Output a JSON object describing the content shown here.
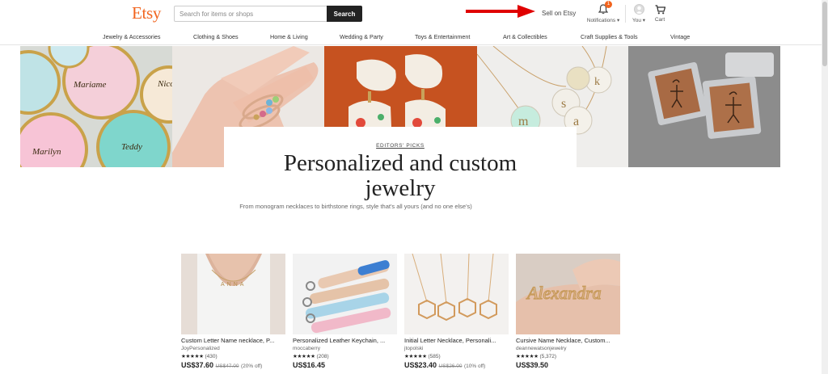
{
  "header": {
    "logo": "Etsy",
    "search_placeholder": "Search for items or shops",
    "search_button": "Search",
    "sell_link": "Sell on Etsy",
    "notifications_label": "Notifications ▾",
    "notifications_count": "1",
    "you_label": "You ▾",
    "cart_label": "Cart"
  },
  "categories": [
    "Jewelry & Accessories",
    "Clothing & Shoes",
    "Home & Living",
    "Wedding & Party",
    "Toys & Entertainment",
    "Art & Collectibles",
    "Craft Supplies & Tools",
    "Vintage"
  ],
  "hero": {
    "eyebrow": "EDITORS' PICKS",
    "headline_line1": "Personalized and custom",
    "headline_line2": "jewelry",
    "subtitle": "From monogram necklaces to birthstone rings, style that's all yours (and no one else's)",
    "dish_names": [
      "Mariame",
      "Nico",
      "Marilyn",
      "Teddy"
    ],
    "charm_letters": [
      "s",
      "k",
      "m",
      "a"
    ]
  },
  "products": [
    {
      "title": "Custom Letter Name necklace, P...",
      "shop": "JoyPersonalized",
      "stars": "★★★★★",
      "reviews": "(430)",
      "price": "US$37.60",
      "original_price": "US$47.00",
      "discount": "(20% off)",
      "necklace_letters": "ANNA"
    },
    {
      "title": "Personalized Leather Keychain, ...",
      "shop": "moccaberry",
      "stars": "★★★★★",
      "reviews": "(208)",
      "price": "US$16.45",
      "original_price": "",
      "discount": ""
    },
    {
      "title": "Initial Letter Necklace, Personali...",
      "shop": "jtopolski",
      "stars": "★★★★★",
      "reviews": "(585)",
      "price": "US$23.40",
      "original_price": "US$26.00",
      "discount": "(10% off)"
    },
    {
      "title": "Cursive Name Necklace, Custom...",
      "shop": "deannewatsonjewelry",
      "stars": "★★★★★",
      "reviews": "(5,372)",
      "price": "US$39.50",
      "original_price": "",
      "discount": "",
      "wire_name": "Alexandra"
    }
  ],
  "colors": {
    "brand": "#f1641e",
    "annotation_arrow": "#e00000"
  }
}
